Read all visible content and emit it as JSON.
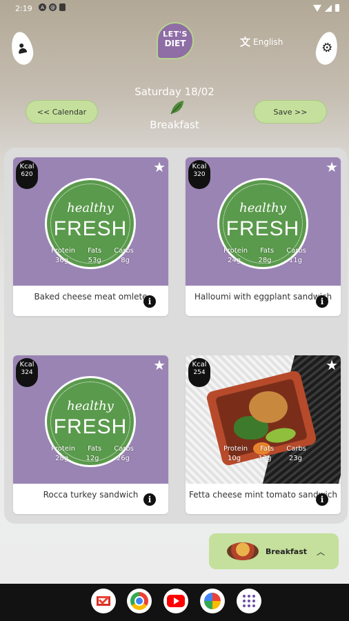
{
  "status": {
    "time": "2:19"
  },
  "header": {
    "logo_line1": "LET'S",
    "logo_line2": "DIET",
    "language": "English",
    "date": "Saturday 18/02",
    "meal": "Breakfast",
    "calendar_button": "<< Calendar",
    "save_button": "Save >>"
  },
  "cards": [
    {
      "kcal_label": "Kcal",
      "kcal": "620",
      "name": "Baked cheese meat omlete",
      "macro_labels": [
        "Protein",
        "Fats",
        "Carbs"
      ],
      "macro_values": [
        "36g",
        "53g",
        "8g"
      ],
      "badge_line1": "healthy",
      "badge_line2": "FRESH"
    },
    {
      "kcal_label": "Kcal",
      "kcal": "320",
      "name": "Halloumi with eggplant sandwich",
      "macro_labels": [
        "Protein",
        "Fats",
        "Carbs"
      ],
      "macro_values": [
        "24g",
        "28g",
        "11g"
      ],
      "badge_line1": "healthy",
      "badge_line2": "FRESH"
    },
    {
      "kcal_label": "Kcal",
      "kcal": "324",
      "name": "Rocca turkey sandwich",
      "macro_labels": [
        "Protein",
        "Fats",
        "Carbs"
      ],
      "macro_values": [
        "28g",
        "12g",
        "26g"
      ],
      "badge_line1": "healthy",
      "badge_line2": "FRESH"
    },
    {
      "kcal_label": "Kcal",
      "kcal": "254",
      "name": "Fetta cheese mint tomato sandwich",
      "macro_labels": [
        "Protein",
        "Fats",
        "Carbs"
      ],
      "macro_values": [
        "10g",
        "13g",
        "23g"
      ]
    }
  ],
  "meal_tab": {
    "label": "Breakfast"
  }
}
